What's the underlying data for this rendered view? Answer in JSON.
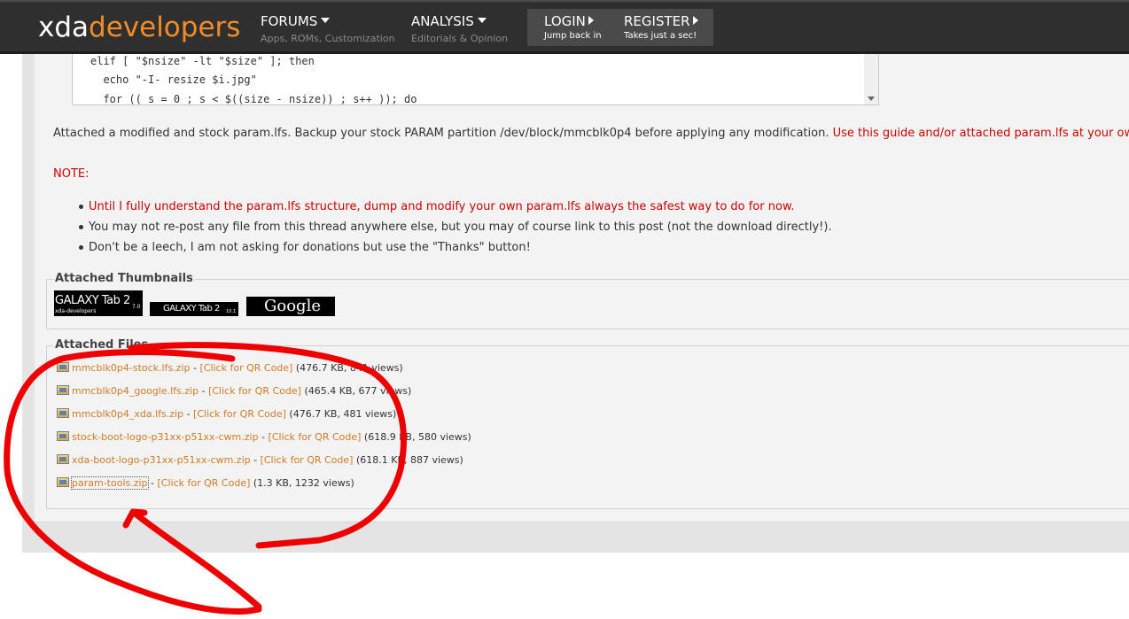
{
  "header": {
    "logo_part1": "xda",
    "logo_part2": "developers",
    "nav": [
      {
        "label": "FORUMS",
        "sub": "Apps, ROMs, Customization"
      },
      {
        "label": "ANALYSIS",
        "sub": "Editorials & Opinion"
      }
    ],
    "login": {
      "label": "LOGIN",
      "sub": "Jump back in"
    },
    "register": {
      "label": "REGISTER",
      "sub": "Takes just a sec!"
    }
  },
  "code": {
    "lines": [
      "elif [ \"$nsize\" -lt \"$size\" ]; then",
      "  echo \"-I- resize $i.jpg\"",
      "  for (( s = 0 ; s < $((size - nsize)) ; s++ )); do"
    ]
  },
  "post": {
    "attached_text": "Attached a modified and stock param.lfs. Backup your stock PARAM partition /dev/block/mmcblk0p4 before applying any modification.",
    "risk_text": "Use this guide and/or attached param.lfs at your own risk!",
    "note": "NOTE:",
    "bullets": [
      "Until I fully understand the param.lfs structure, dump and modify your own param.lfs always the safest way to do for now.",
      "You may not re-post any file from this thread anywhere else, but you may of course link to this post (not the download directly!).",
      "Don't be a leech, I am not asking for donations but use the \"Thanks\" button!"
    ]
  },
  "thumbnails": {
    "legend": "Attached Thumbnails",
    "items": [
      {
        "main": "GALAXY Tab 2",
        "small": "7.0",
        "caption": "xda-developers"
      },
      {
        "main": "GALAXY Tab 2",
        "small": "10.1",
        "caption": ""
      },
      {
        "main": "Google"
      }
    ]
  },
  "files": {
    "legend": "Attached Files",
    "qr_label": "[Click for QR Code]",
    "items": [
      {
        "name": "mmcblk0p4-stock.lfs.zip",
        "info": "(476.7 KB, 841 views)"
      },
      {
        "name": "mmcblk0p4_google.lfs.zip",
        "info": "(465.4 KB, 677 views)"
      },
      {
        "name": "mmcblk0p4_xda.lfs.zip",
        "info": "(476.7 KB, 481 views)"
      },
      {
        "name": "stock-boot-logo-p31xx-p51xx-cwm.zip",
        "info": "(618.9 KB, 580 views)"
      },
      {
        "name": "xda-boot-logo-p31xx-p51xx-cwm.zip",
        "info": "(618.1 KB, 887 views)"
      },
      {
        "name": "param-tools.zip",
        "info": "(1.3 KB, 1232 views)"
      }
    ]
  },
  "colors": {
    "brand_orange": "#f28c28",
    "link": "#d17a28",
    "warning_red": "#cc0000",
    "annotation_red": "#ee0000"
  }
}
